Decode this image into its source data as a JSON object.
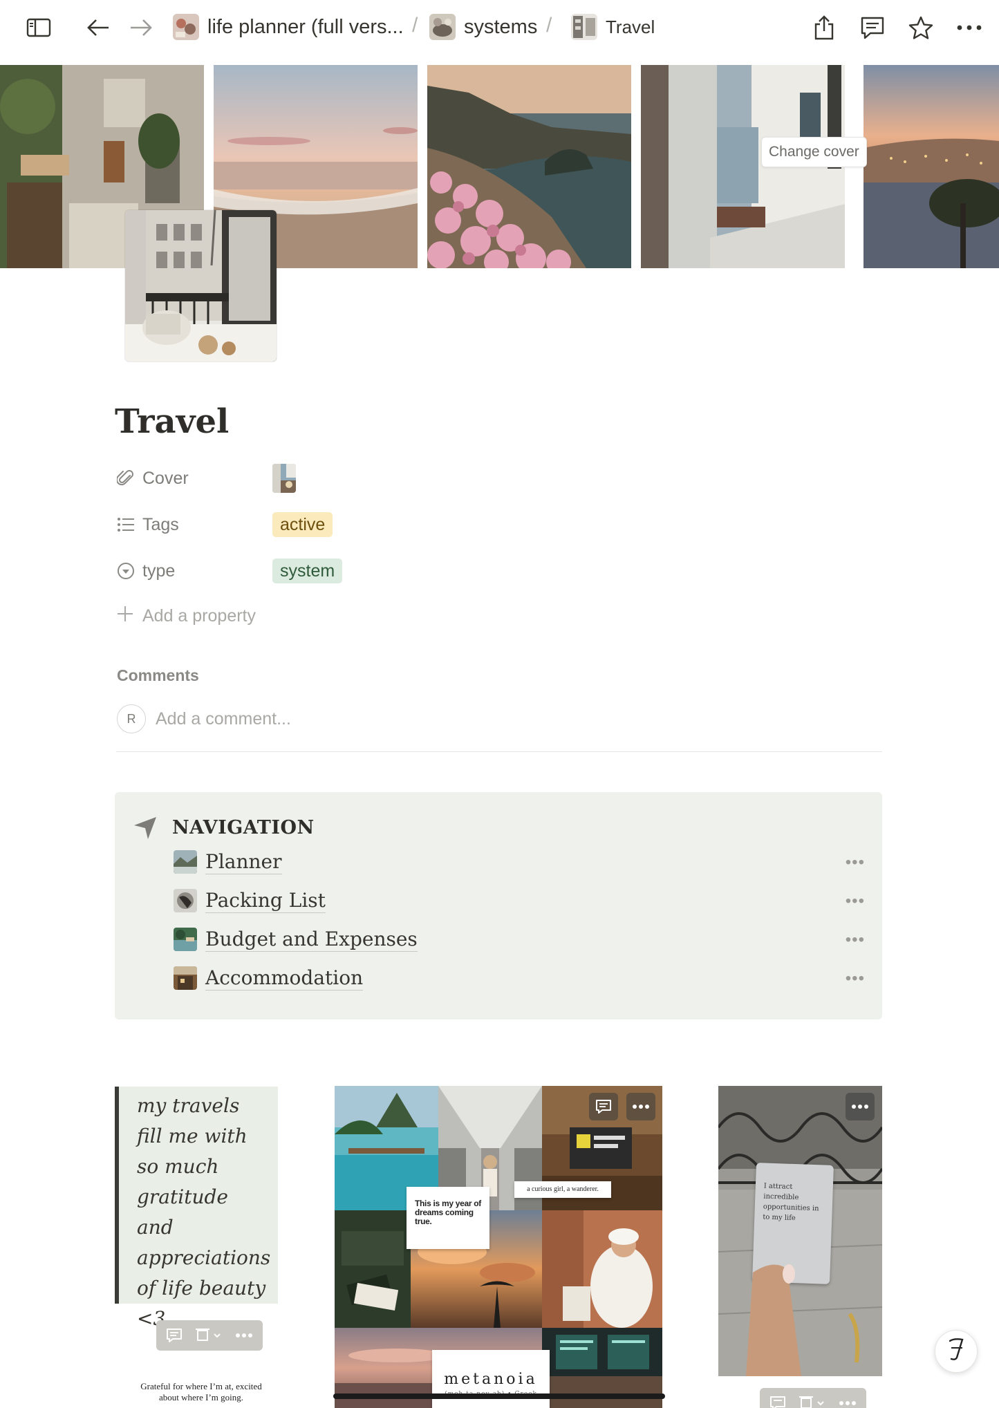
{
  "topbar": {
    "breadcrumbs": [
      {
        "label": "life planner (full vers..."
      },
      {
        "label": "systems"
      },
      {
        "label": "Travel"
      }
    ],
    "separator": "/"
  },
  "cover": {
    "change_cover_label": "Change cover"
  },
  "page": {
    "title": "Travel",
    "properties": [
      {
        "name": "Cover",
        "icon": "paperclip-icon"
      },
      {
        "name": "Tags",
        "icon": "list-icon",
        "value": "active",
        "color": "#fbeabc"
      },
      {
        "name": "type",
        "icon": "select-icon",
        "value": "system",
        "color": "#dcebdf"
      }
    ],
    "add_property_label": "Add a property",
    "comments": {
      "label": "Comments",
      "avatar_initial": "R",
      "placeholder": "Add a comment..."
    }
  },
  "navigation": {
    "heading": "NAVIGATION",
    "items": [
      {
        "label": "Planner"
      },
      {
        "label": "Packing List"
      },
      {
        "label": "Budget and Expenses"
      },
      {
        "label": "Accommodation"
      }
    ]
  },
  "gallery": {
    "quote": "my travels fill me with so much gratitude and appreciations of life beauty <3",
    "grateful_caption": "Grateful for where I’m at, excited about where I’m going.",
    "collage_notes": {
      "dreams": "This is my year of dreams coming true.",
      "wanderer": "a curious girl, a wanderer.",
      "metanoia": "metanoia",
      "metanoia_sub": "(meh-ta-noy-ah) • Greek"
    },
    "card_text": "I attract incredible opportunities in to my life"
  }
}
